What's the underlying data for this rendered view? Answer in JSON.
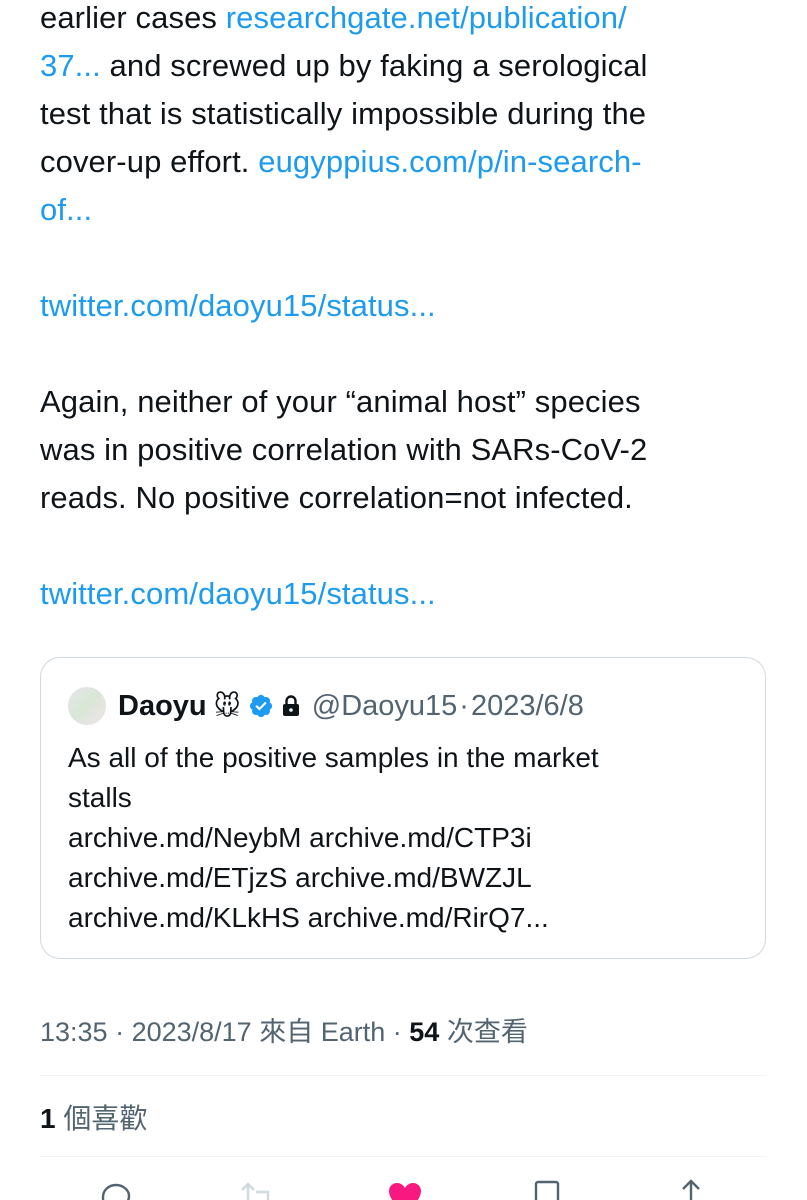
{
  "tweet": {
    "lines": [
      {
        "t1": "earlier cases ",
        "link1": "researchgate.net/publication/"
      },
      {
        "link1": "37...",
        "t1": " and screwed up by faking a serological"
      },
      {
        "t1": "test that is statistically impossible during the"
      },
      {
        "t1": "cover-up effort. ",
        "link1": "eugyppius.com/p/in-search-"
      },
      {
        "link1": "of..."
      }
    ],
    "link_status_1": "twitter.com/daoyu15/status...",
    "para2": [
      "Again, neither of your “animal host” species",
      "was in positive correlation with SARs-CoV-2",
      "reads. No positive correlation=not infected."
    ],
    "link_status_2": "twitter.com/daoyu15/status..."
  },
  "quote": {
    "name": "Daoyu",
    "emoji": "🐭",
    "handle": "@Daoyu15",
    "separator": "·",
    "date": "2023/6/8",
    "lines": [
      "As all of the positive samples in the market",
      "stalls",
      "archive.md/NeybM archive.md/CTP3i",
      "archive.md/ETjzS archive.md/BWZJL",
      "archive.md/KLkHS archive.md/RirQ7..."
    ],
    "colors": {
      "verified": "#1d9bf0"
    }
  },
  "meta": {
    "time": "13:35",
    "separator": " · ",
    "date": "2023/8/17",
    "source": "來自 Earth",
    "views_count": "54",
    "views_label": "次查看"
  },
  "likes": {
    "count": "1",
    "label": "個喜歡"
  },
  "colors": {
    "link": "#1d9bf0",
    "like": "#f91880",
    "muted": "#536471"
  },
  "icons": [
    "reply-icon",
    "retweet-icon",
    "like-icon",
    "bookmark-icon",
    "share-icon"
  ]
}
